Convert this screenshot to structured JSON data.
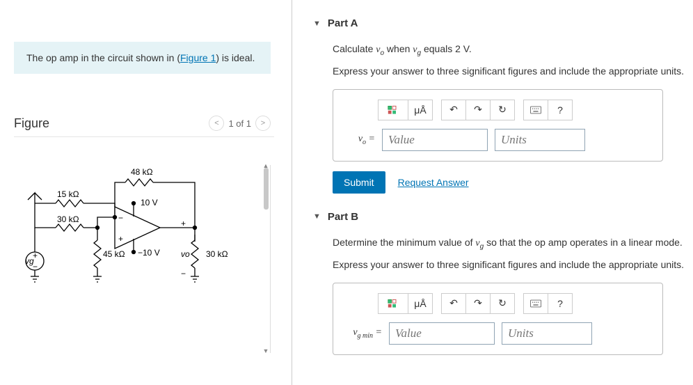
{
  "problem": {
    "text_before": "The op amp in the circuit shown in (",
    "link": "Figure 1",
    "text_after": ") is ideal."
  },
  "figure": {
    "title": "Figure",
    "pager": "1 of 1",
    "labels": {
      "r1": "48 kΩ",
      "r2": "15 kΩ",
      "r3": "30 kΩ",
      "r4": "45 kΩ",
      "r5": "30 kΩ",
      "vplus": "10 V",
      "vminus": "−10 V",
      "vg": "vg",
      "vo": "vo",
      "plus_in": "+",
      "minus_in": "−",
      "plus_out": "+",
      "minus_out": "−"
    }
  },
  "partA": {
    "title": "Part A",
    "prompt_before": "Calculate ",
    "var1": "v",
    "var1_sub": "o",
    "prompt_mid": " when ",
    "var2": "v",
    "var2_sub": "g",
    "prompt_after": " equals 2 V.",
    "instruction": "Express your answer to three significant figures and include the appropriate units.",
    "var_label": "v",
    "var_label_sub": "o",
    "eq": " =",
    "value_ph": "Value",
    "units_ph": "Units",
    "submit": "Submit",
    "request": "Request Answer"
  },
  "partB": {
    "title": "Part B",
    "prompt_before": "Determine the minimum value of ",
    "var1": "v",
    "var1_sub": "g",
    "prompt_after": " so that the op amp operates in a linear mode.",
    "instruction": "Express your answer to three significant figures and include the appropriate units.",
    "var_label": "v",
    "var_label_sub": "g min",
    "eq": " =",
    "value_ph": "Value",
    "units_ph": "Units"
  },
  "tools": {
    "mu": "μÅ",
    "help": "?"
  }
}
